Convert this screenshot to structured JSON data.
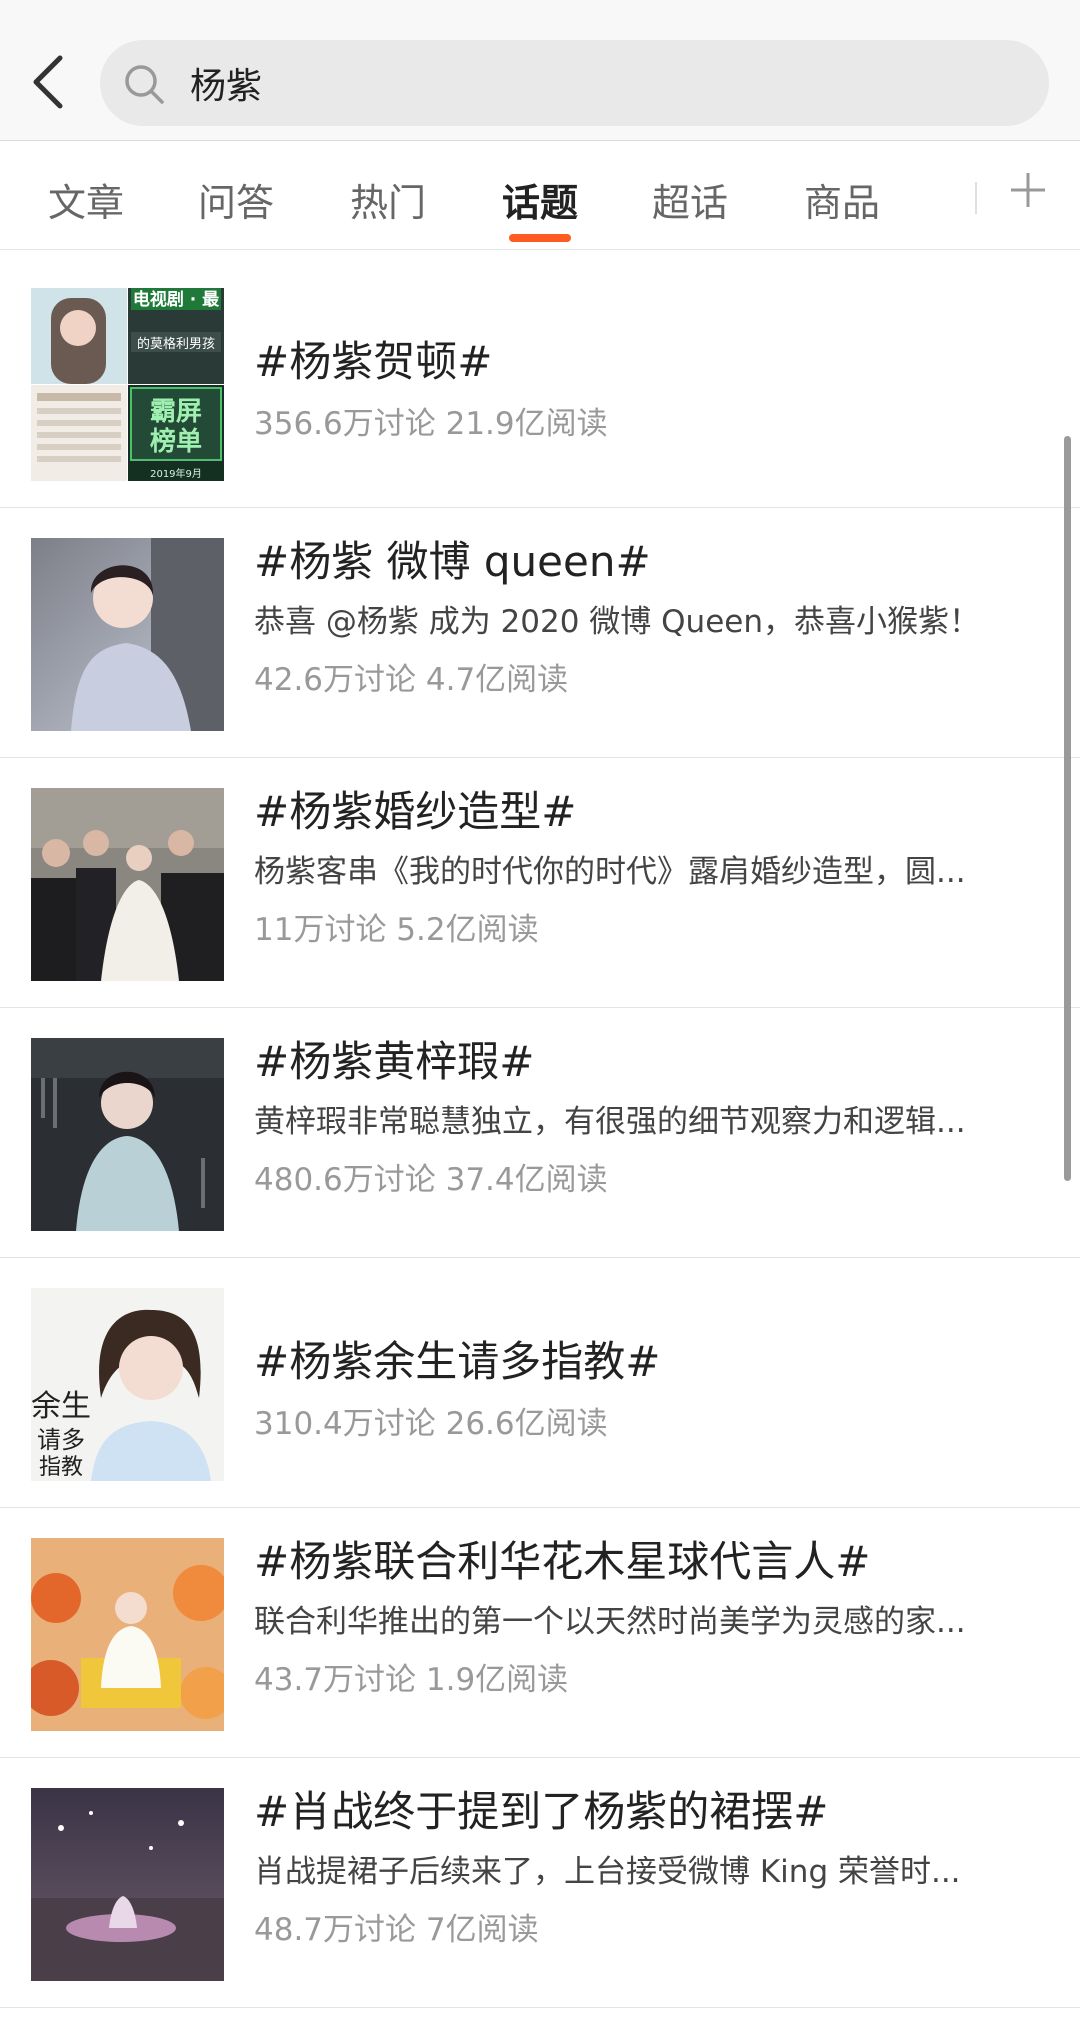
{
  "search": {
    "query": "杨紫"
  },
  "tabs": [
    {
      "label": "文章"
    },
    {
      "label": "问答"
    },
    {
      "label": "热门"
    },
    {
      "label": "话题",
      "active": true
    },
    {
      "label": "超话"
    },
    {
      "label": "商品"
    }
  ],
  "accent_color": "#ff5a1f",
  "topics": [
    {
      "title": "#杨紫贺顿#",
      "desc": "",
      "stats": "356.6万讨论 21.9亿阅读"
    },
    {
      "title": "#杨紫 微博 queen#",
      "desc": "恭喜 @杨紫 成为 2020 微博 Queen，恭喜小猴紫！",
      "stats": "42.6万讨论 4.7亿阅读"
    },
    {
      "title": "#杨紫婚纱造型#",
      "desc": "杨紫客串《我的时代你的时代》露肩婚纱造型，圆...",
      "stats": "11万讨论 5.2亿阅读"
    },
    {
      "title": "#杨紫黄梓瑕#",
      "desc": "黄梓瑕非常聪慧独立，有很强的细节观察力和逻辑...",
      "stats": "480.6万讨论 37.4亿阅读"
    },
    {
      "title": "#杨紫余生请多指教#",
      "desc": "",
      "stats": "310.4万讨论 26.6亿阅读"
    },
    {
      "title": "#杨紫联合利华花木星球代言人#",
      "desc": "联合利华推出的第一个以天然时尚美学为灵感的家...",
      "stats": "43.7万讨论 1.9亿阅读"
    },
    {
      "title": "#肖战终于提到了杨紫的裙摆#",
      "desc": "肖战提裙子后续来了，上台接受微博 King 荣誉时...",
      "stats": "48.7万讨论 7亿阅读"
    }
  ],
  "thumb1_text": {
    "line1": "电视剧 · 最",
    "line2": "的莫格利男孩",
    "line3": "霸屏",
    "line4": "榜单",
    "line5": "2019年9月"
  },
  "thumb5_text": {
    "line1": "余生",
    "line2": "请多",
    "line3": "指教"
  }
}
